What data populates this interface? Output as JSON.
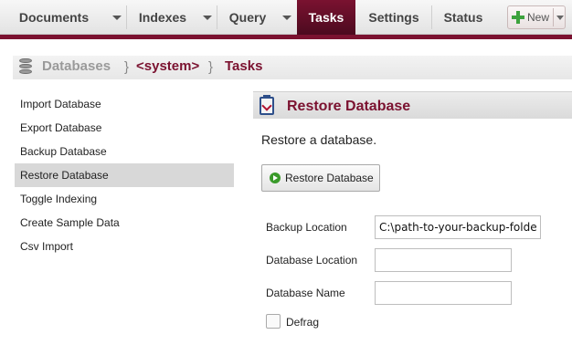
{
  "nav": {
    "tabs": [
      {
        "label": "Documents"
      },
      {
        "label": "Indexes"
      },
      {
        "label": "Query"
      },
      {
        "label": "Tasks",
        "active": true
      },
      {
        "label": "Settings"
      },
      {
        "label": "Status"
      }
    ],
    "new_button": "New"
  },
  "breadcrumb": {
    "root": "Databases",
    "database": "<system>",
    "current": "Tasks"
  },
  "sidebar": {
    "items": [
      {
        "label": "Import Database"
      },
      {
        "label": "Export Database"
      },
      {
        "label": "Backup Database"
      },
      {
        "label": "Restore Database",
        "selected": true
      },
      {
        "label": "Toggle Indexing"
      },
      {
        "label": "Create Sample Data"
      },
      {
        "label": "Csv Import"
      }
    ]
  },
  "panel": {
    "title": "Restore Database",
    "description": "Restore a database.",
    "restore_button": "Restore Database",
    "fields": {
      "backup_location": {
        "label": "Backup Location",
        "value": "C:\\path-to-your-backup-folder"
      },
      "database_location": {
        "label": "Database Location",
        "value": ""
      },
      "database_name": {
        "label": "Database Name",
        "value": ""
      }
    },
    "defrag": {
      "label": "Defrag",
      "checked": false
    }
  },
  "colors": {
    "accent": "#7b1230",
    "selected_row": "#d8d8d8",
    "play_green": "#3a9a2a"
  }
}
